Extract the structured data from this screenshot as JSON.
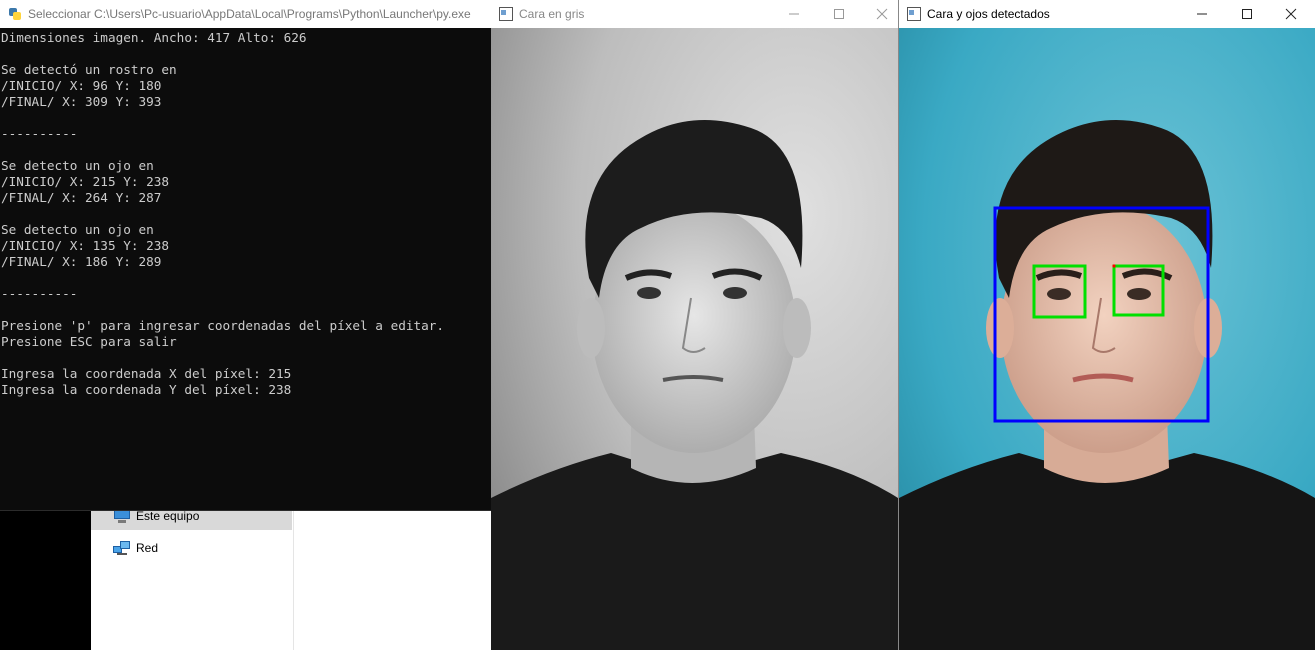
{
  "console": {
    "title": "Seleccionar C:\\Users\\Pc-usuario\\AppData\\Local\\Programs\\Python\\Launcher\\py.exe",
    "lines": [
      "Dimensiones imagen. Ancho: 417 Alto: 626",
      "",
      "Se detectó un rostro en",
      "/INICIO/ X: 96 Y: 180",
      "/FINAL/ X: 309 Y: 393",
      "",
      "----------",
      "",
      "Se detecto un ojo en",
      "/INICIO/ X: 215 Y: 238",
      "/FINAL/ X: 264 Y: 287",
      "",
      "Se detecto un ojo en",
      "/INICIO/ X: 135 Y: 238",
      "/FINAL/ X: 186 Y: 289",
      "",
      "----------",
      "",
      "Presione 'p' para ingresar coordenadas del píxel a editar.",
      "Presione ESC para salir",
      "",
      "Ingresa la coordenada X del píxel: 215",
      "Ingresa la coordenada Y del píxel: 238"
    ]
  },
  "explorer": {
    "items": [
      {
        "label": "Este equipo",
        "icon": "computer-icon"
      },
      {
        "label": "Red",
        "icon": "network-icon"
      }
    ]
  },
  "gray_window": {
    "title": "Cara en gris"
  },
  "color_window": {
    "title": "Cara y ojos detectados"
  },
  "detections": {
    "face_color": "#0000ff",
    "eye_color": "#00e000"
  },
  "colors": {
    "console_bg": "#0c0c0c",
    "console_text": "#cccccc",
    "teal_bg": "#3aa9c4"
  }
}
